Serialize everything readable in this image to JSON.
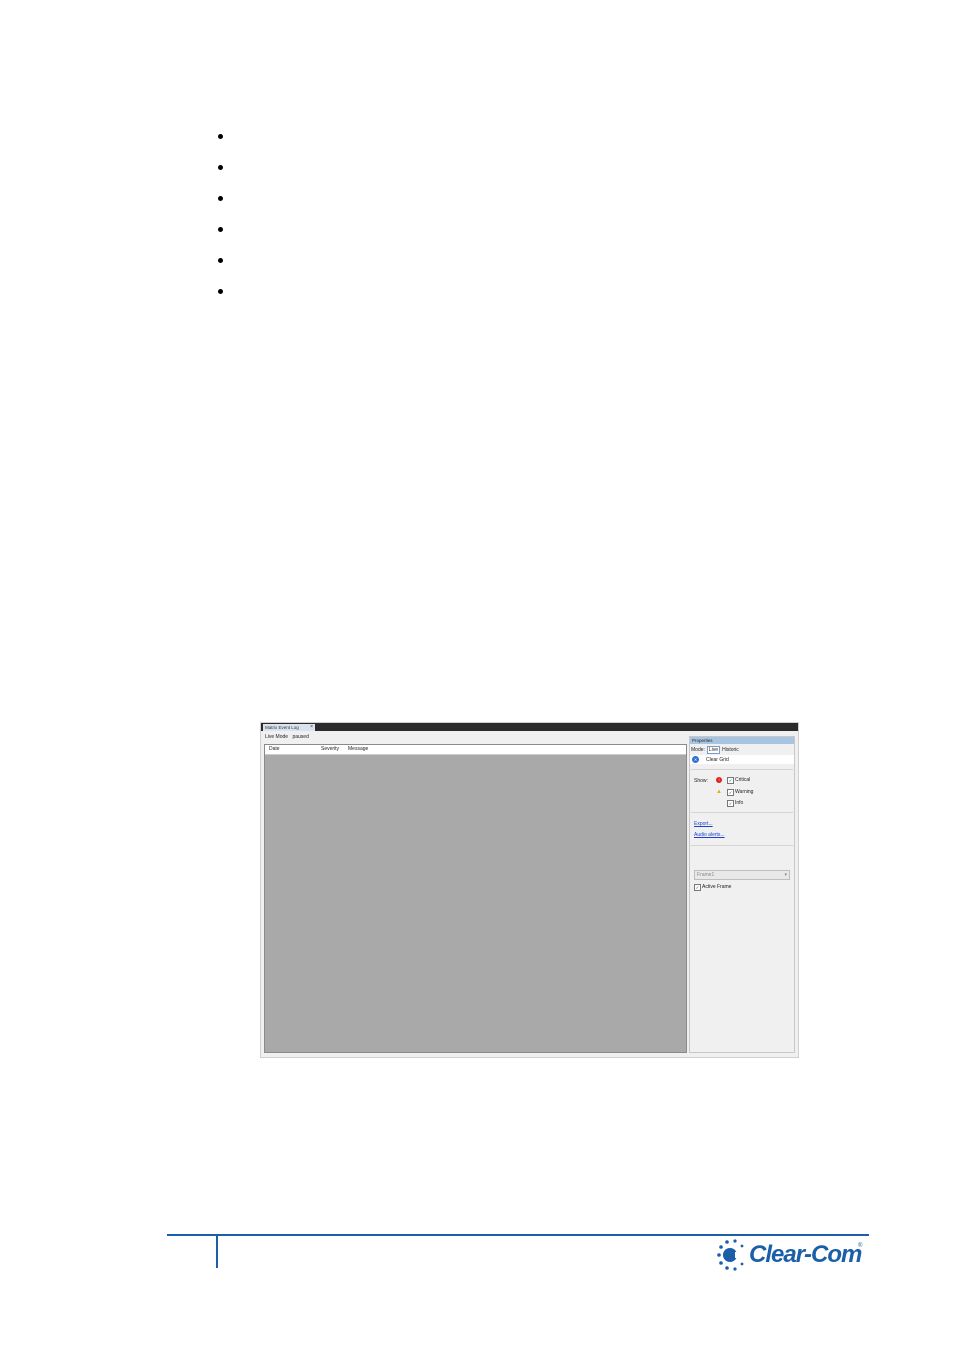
{
  "bullets": [
    "",
    "",
    "",
    "",
    "",
    ""
  ],
  "screenshot": {
    "tab_title": "Matrix Event Log",
    "tab_close": "×",
    "live_mode_label": "Live Mode",
    "live_mode_status": "paused",
    "grid_columns": [
      "Date",
      "Severity",
      "Message"
    ],
    "properties": {
      "title": "Properties",
      "mode_label": "Mode:",
      "mode_live": "Live",
      "mode_historic": "Historic",
      "clear_grid": "Clear Grid",
      "show_label": "Show:",
      "severities": [
        {
          "label": "Critical",
          "checked": "✓",
          "icon": "critical-icon"
        },
        {
          "label": "Warning",
          "checked": "✓",
          "icon": "warning-icon"
        },
        {
          "label": "Info",
          "checked": "✓",
          "icon": ""
        }
      ],
      "export_link": "Export...",
      "audio_alerts_link": "Audio alerts...",
      "frame_select": "Frame1",
      "active_frame_label": "Active Frame",
      "active_frame_checked": "✓"
    }
  },
  "footer": {
    "logo_text": "Clear-Com",
    "logo_reg": "®",
    "colors": {
      "brand": "#1a5fa8"
    }
  }
}
